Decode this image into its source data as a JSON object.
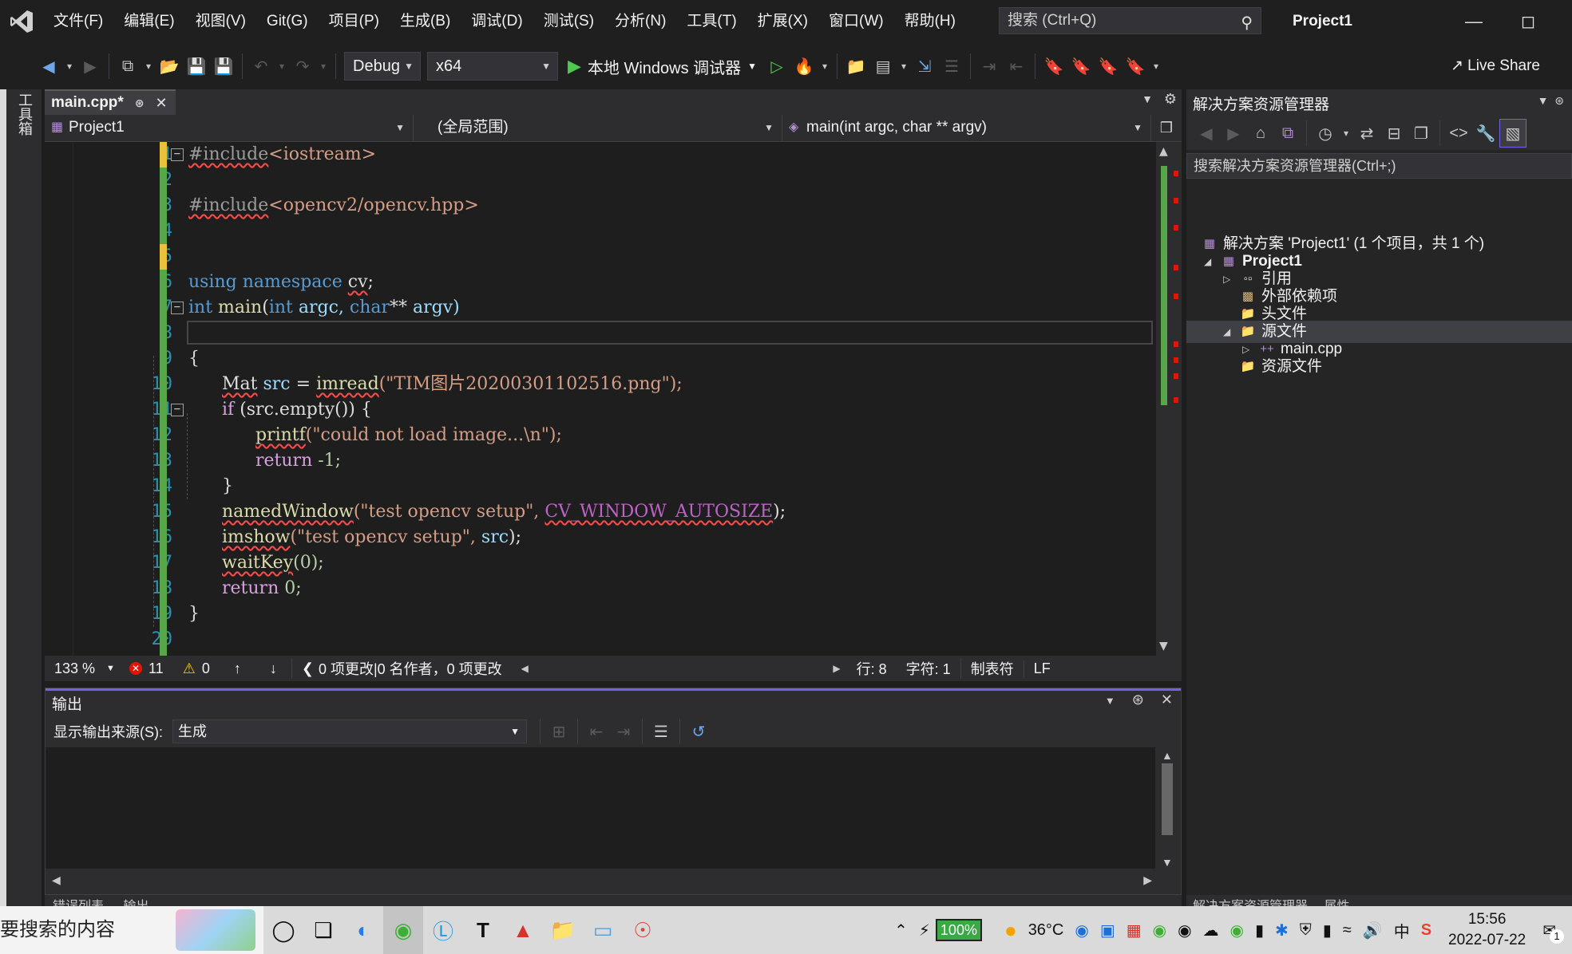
{
  "menu": [
    "文件(F)",
    "编辑(E)",
    "视图(V)",
    "Git(G)",
    "项目(P)",
    "生成(B)",
    "调试(D)",
    "测试(S)",
    "分析(N)",
    "工具(T)",
    "扩展(X)",
    "窗口(W)",
    "帮助(H)"
  ],
  "search": {
    "placeholder": "搜索 (Ctrl+Q)"
  },
  "window_title": "Project1",
  "toolbar": {
    "config": "Debug",
    "platform": "x64",
    "run_label": "本地 Windows 调试器",
    "live_share": "Live Share"
  },
  "left_strip": {
    "toolbox": "工具箱"
  },
  "doc_tab": {
    "name": "main.cpp*"
  },
  "navbar": {
    "project": "Project1",
    "scope": "(全局范围)",
    "member": "main(int argc, char ** argv)"
  },
  "code_lines": [
    {
      "n": "1"
    },
    {
      "n": "2"
    },
    {
      "n": "3"
    },
    {
      "n": "4"
    },
    {
      "n": "5"
    },
    {
      "n": "6"
    },
    {
      "n": "7"
    },
    {
      "n": "8"
    },
    {
      "n": "9"
    },
    {
      "n": "10"
    },
    {
      "n": "11"
    },
    {
      "n": "12"
    },
    {
      "n": "13"
    },
    {
      "n": "14"
    },
    {
      "n": "15"
    },
    {
      "n": "16"
    },
    {
      "n": "17"
    },
    {
      "n": "18"
    },
    {
      "n": "19"
    },
    {
      "n": "20"
    }
  ],
  "code": {
    "l1_a": "#include",
    "l1_b": "<iostream>",
    "l3_a": "#include",
    "l3_b": "<opencv2/opencv.hpp>",
    "l6_a": "using",
    "l6_b": "namespace",
    "l6_c": "cv",
    "l6_d": ";",
    "l7_a": "int",
    "l7_b": "main",
    "l7_c": "(",
    "l7_d": "int",
    "l7_e": "argc,",
    "l7_f": "char",
    "l7_g": "**",
    "l7_h": "argv)",
    "l9": "{",
    "l10_a": "Mat",
    "l10_b": "src",
    "l10_c": "=",
    "l10_d": "imread",
    "l10_e": "(\"TIM图片20200301102516.png\");",
    "l11_a": "if",
    "l11_b": "(src.empty()) {",
    "l12_a": "printf",
    "l12_b": "(\"could not load image...\\n\");",
    "l13_a": "return",
    "l13_b": "-1;",
    "l14": "}",
    "l15_a": "namedWindow",
    "l15_b": "(\"test opencv setup\",",
    "l15_c": "CV_WINDOW_AUTOSIZE",
    "l15_d": ");",
    "l16_a": "imshow",
    "l16_b": "(\"test opencv setup\",",
    "l16_c": "src",
    "l16_d": ");",
    "l17_a": "waitKey",
    "l17_b": "(0);",
    "l18_a": "return",
    "l18_b": "0;",
    "l19": "}"
  },
  "editor_status": {
    "zoom": "133 %",
    "errors": "11",
    "warnings": "0",
    "changes": "0 项更改|0 名作者，0 项更改",
    "line": "行: 8",
    "char": "字符: 1",
    "tabs": "制表符",
    "eol": "LF"
  },
  "output": {
    "title": "输出",
    "source_label": "显示输出来源(S):",
    "source_value": "生成"
  },
  "bottom_tabs": [
    "错误列表",
    "输出"
  ],
  "solution": {
    "title": "解决方案资源管理器",
    "search_placeholder": "搜索解决方案资源管理器(Ctrl+;)",
    "items": [
      {
        "label": "解决方案 'Project1' (1 个项目，共 1 个)"
      },
      {
        "label": "Project1"
      },
      {
        "label": "引用"
      },
      {
        "label": "外部依赖项"
      },
      {
        "label": "头文件"
      },
      {
        "label": "源文件"
      },
      {
        "label": "main.cpp"
      },
      {
        "label": "资源文件"
      }
    ],
    "bottom_tabs": [
      "解决方案资源管理器",
      "属性"
    ]
  },
  "taskbar": {
    "search_text": "要搜索的内容",
    "battery": "100%",
    "temperature": "36°C",
    "ime": "中",
    "time": "15:56",
    "date": "2022-07-22",
    "notify_count": "1"
  },
  "colors": {
    "accent": "#7160e8",
    "change_bar": "#57a64a",
    "error": "#e51400",
    "keyword": "#569cd6",
    "string": "#d69d85"
  }
}
